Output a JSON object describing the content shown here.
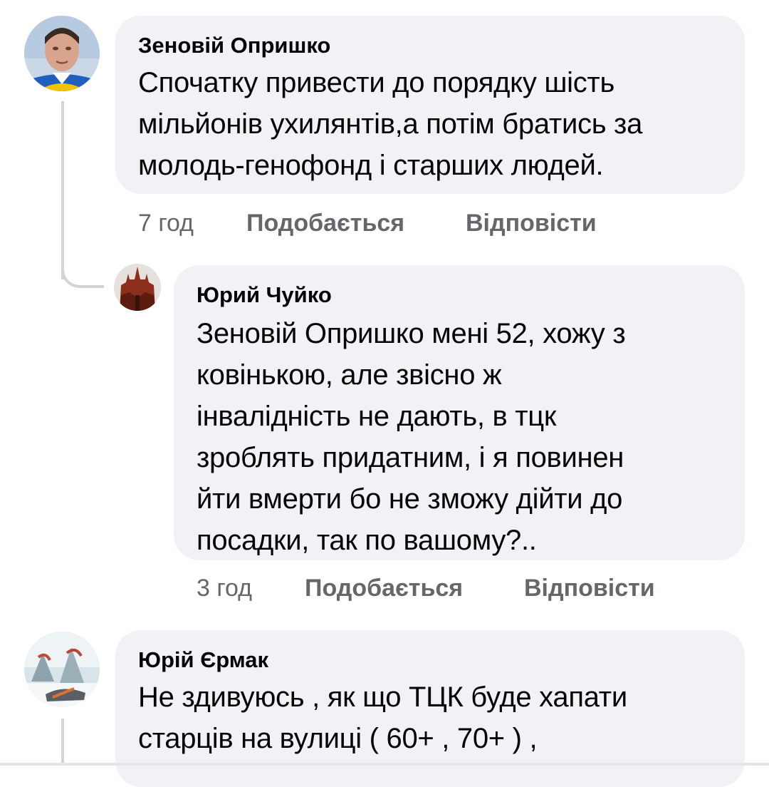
{
  "comments": [
    {
      "author": "Зеновій Опришко",
      "lines": [
        "Спочатку привести до порядку шість",
        "мільйонів ухилянтів,а потім братись за",
        "молодь-генофонд і старших людей."
      ],
      "time": "7 год",
      "like_label": "Подобається",
      "reply_label": "Відповісти",
      "avatar_icon": "person-portrait-icon"
    },
    {
      "author": "Юрий Чуйко",
      "lines": [
        "Зеновій Опришко мені 52, хожу з",
        "ковінькою, але звісно ж",
        "інвалідність не дають, в тцк",
        "зроблять придатним, і я повинен",
        "йти вмерти бо не зможу дійти до",
        "посадки, так по вашому?.."
      ],
      "time": "3 год",
      "like_label": "Подобається",
      "reply_label": "Відповісти",
      "avatar_icon": "church-photo-icon"
    },
    {
      "author": "Юрій Єрмак",
      "lines": [
        "Не здивуюсь , як що ТЦК буде хапати",
        "старців на вулиці  ( 60+ , 70+ ) ,"
      ],
      "avatar_icon": "winter-landscape-icon"
    }
  ],
  "colors": {
    "bubble_bg": "#f0f2f5",
    "text": "#050505",
    "secondary_text": "#65676b",
    "thread_line": "#d2d4d8"
  }
}
